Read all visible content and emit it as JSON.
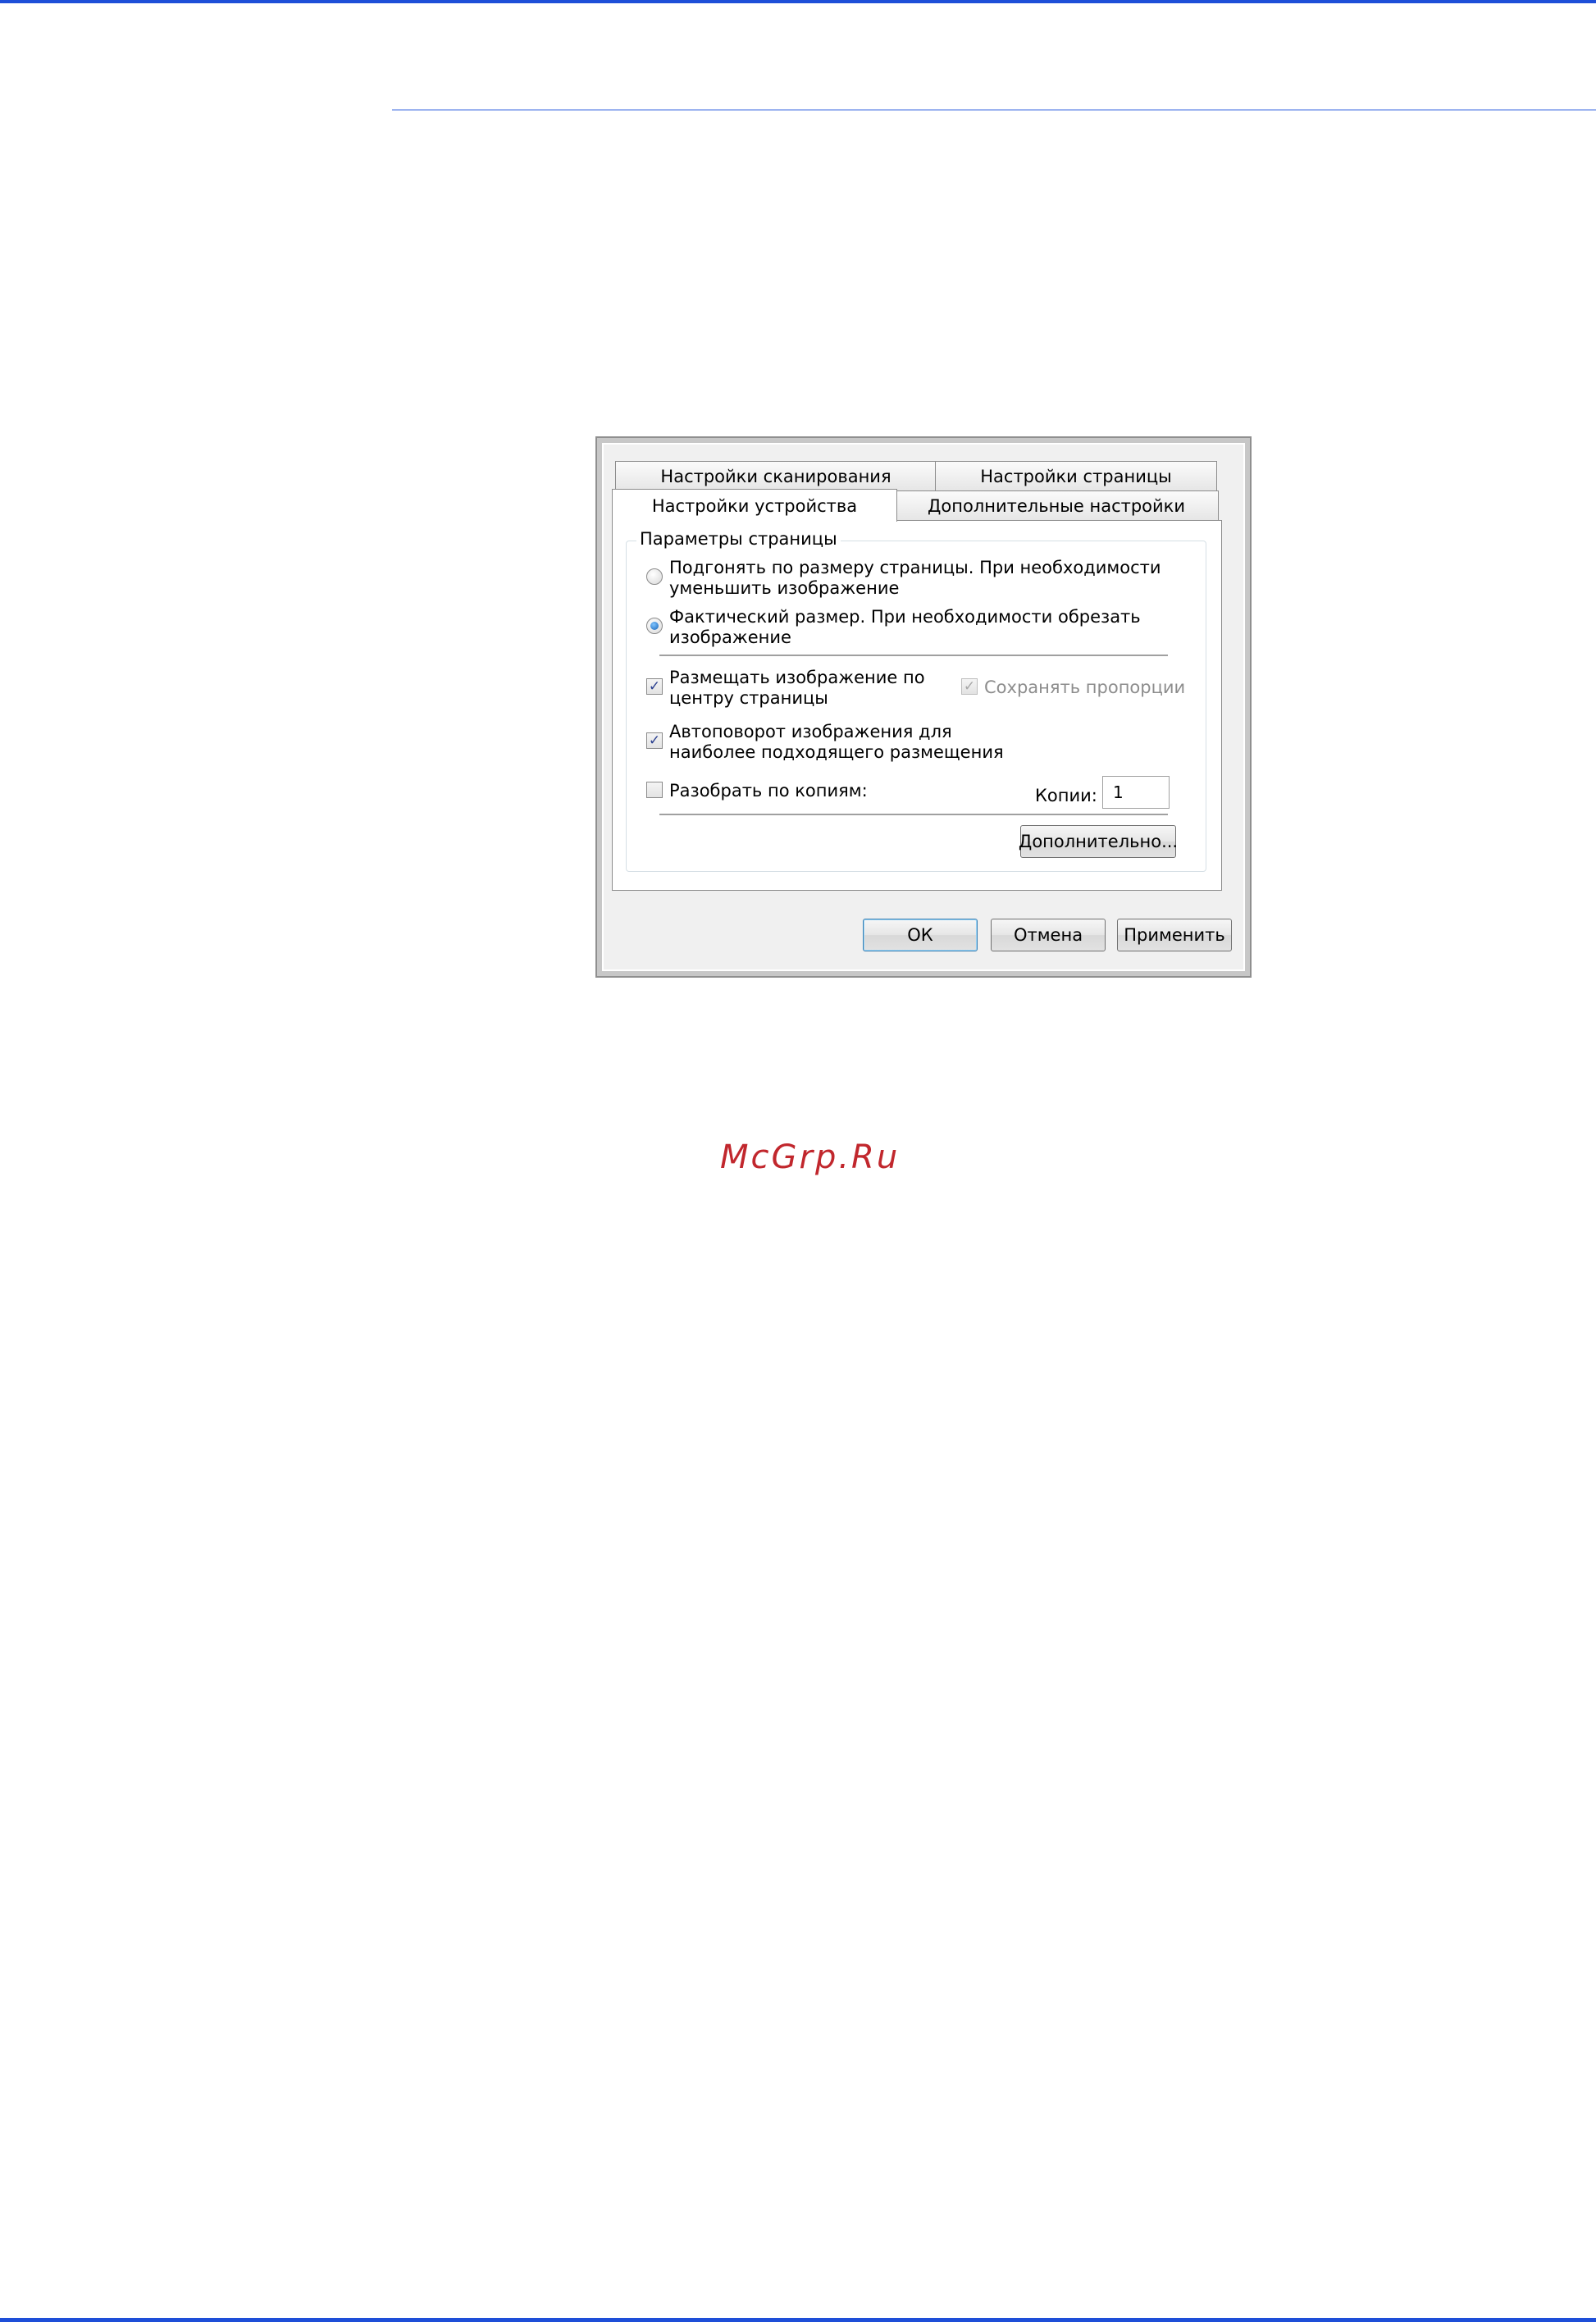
{
  "dialog": {
    "tabs": {
      "scan_settings": "Настройки сканирования",
      "page_settings": "Настройки страницы",
      "device_settings": "Настройки устройства",
      "advanced_settings": "Дополнительные настройки"
    },
    "page_params": {
      "title": "Параметры страницы",
      "fit_to_page": {
        "line1": "Подгонять по размеру страницы. При необходимости",
        "line2": "уменьшить изображение",
        "selected": false
      },
      "actual_size": {
        "line1": "Фактический размер. При необходимости обрезать",
        "line2": "изображение",
        "selected": true
      },
      "center_image": {
        "line1": "Размещать изображение по",
        "line2": "центру страницы",
        "checked": true
      },
      "keep_proportions": {
        "label": "Сохранять пропорции",
        "checked": true,
        "enabled": false
      },
      "auto_rotate": {
        "line1": "Автоповорот изображения для",
        "line2": "наиболее подходящего размещения",
        "checked": true
      },
      "collate": {
        "label": "Разобрать по копиям:",
        "checked": false
      },
      "copies": {
        "label": "Копии:",
        "value": "1"
      },
      "more_button": "Дополнительно..."
    },
    "buttons": {
      "ok": "ОК",
      "cancel": "Отмена",
      "apply": "Применить"
    }
  },
  "watermark": "McGrp.Ru"
}
